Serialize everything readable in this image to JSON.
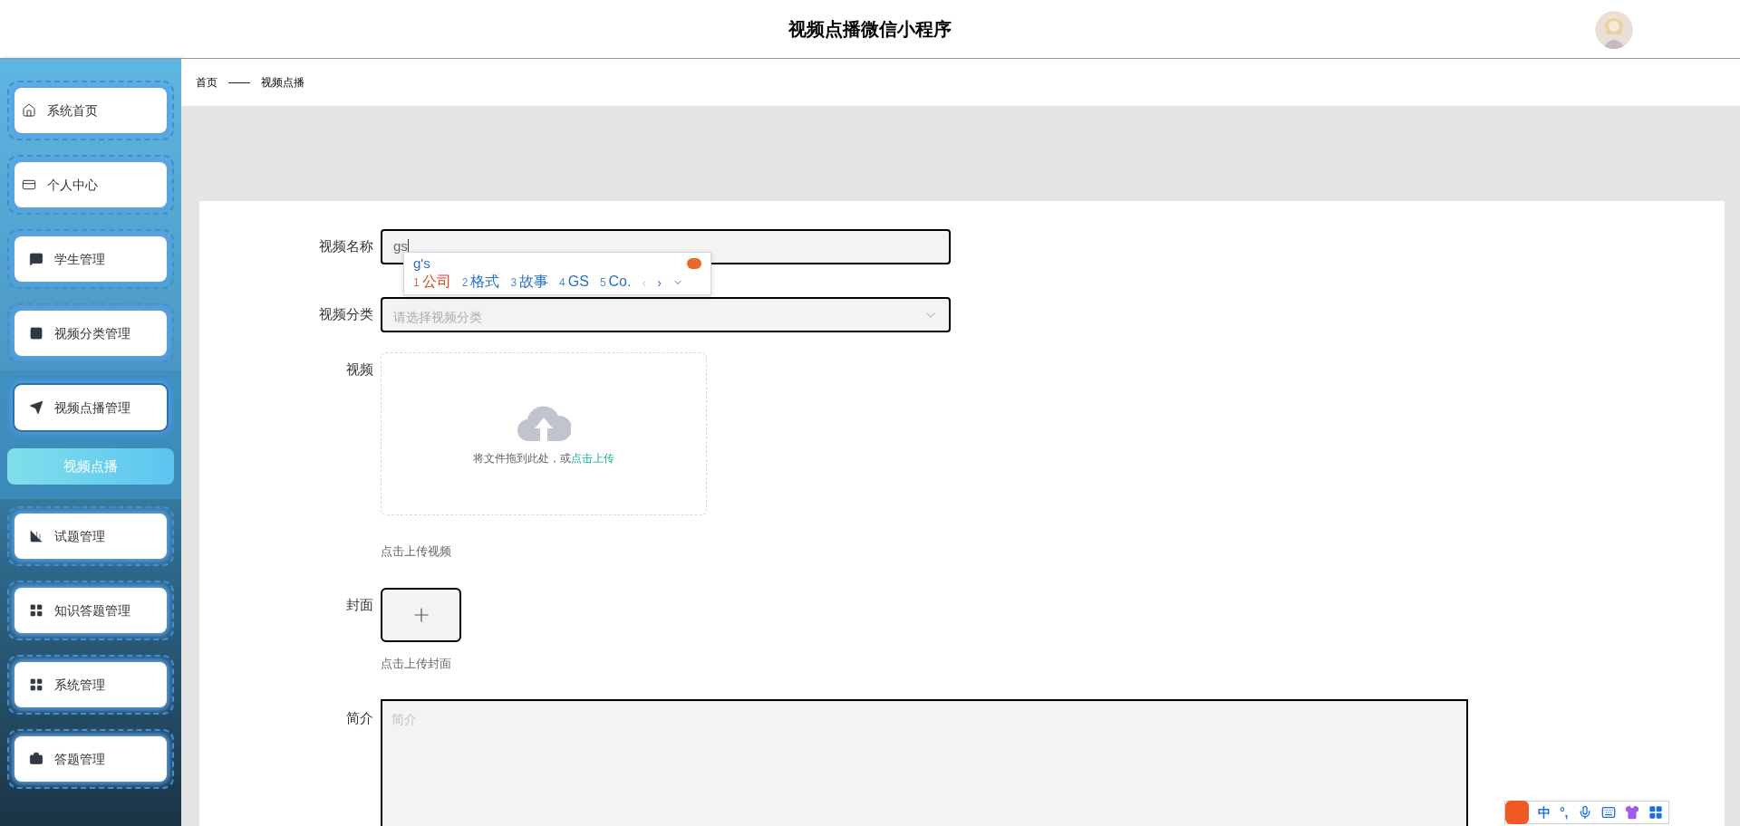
{
  "header": {
    "title": "视频点播微信小程序"
  },
  "sidebar": {
    "items": [
      {
        "label": "系统首页",
        "expanded": false
      },
      {
        "label": "个人中心",
        "expanded": false
      },
      {
        "label": "学生管理",
        "expanded": false
      },
      {
        "label": "视频分类管理",
        "expanded": false
      },
      {
        "label": "视频点播管理",
        "expanded": true,
        "children": [
          {
            "label": "视频点播",
            "selected": true
          }
        ]
      },
      {
        "label": "试题管理",
        "expanded": false
      },
      {
        "label": "知识答题管理",
        "expanded": false
      },
      {
        "label": "系统管理",
        "expanded": false
      },
      {
        "label": "答题管理",
        "expanded": false
      }
    ]
  },
  "breadcrumb": [
    "首页",
    "——",
    "视频点播"
  ],
  "form": {
    "name": {
      "label": "视频名称",
      "value": "gs"
    },
    "category": {
      "label": "视频分类",
      "placeholder": "请选择视频分类"
    },
    "video": {
      "label": "视频",
      "drop_text": "将文件拖到此处，或",
      "drop_link": "点击上传",
      "hint": "点击上传视频"
    },
    "cover": {
      "label": "封面",
      "hint": "点击上传封面"
    },
    "intro": {
      "label": "简介",
      "placeholder": "简介"
    }
  },
  "ime_popup": {
    "composition": "g's",
    "candidates": [
      {
        "index": "1",
        "text": "公司",
        "selected": true
      },
      {
        "index": "2",
        "text": "格式",
        "selected": false
      },
      {
        "index": "3",
        "text": "故事",
        "selected": false
      },
      {
        "index": "4",
        "text": "GS",
        "selected": false
      },
      {
        "index": "5",
        "text": "Co.",
        "selected": false
      }
    ],
    "prev": "‹",
    "next": "›"
  },
  "ime_toolbar": {
    "mode": "中",
    "punct": "°,"
  }
}
